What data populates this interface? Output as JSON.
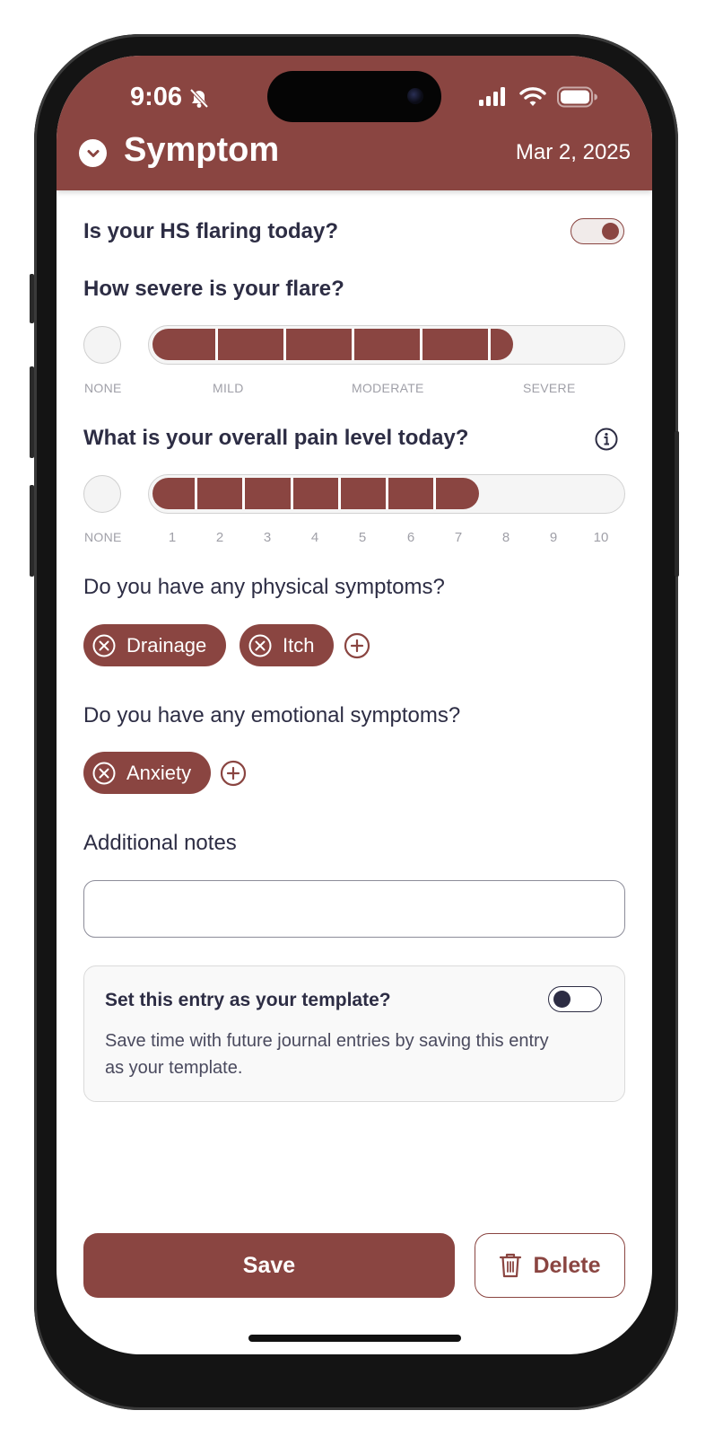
{
  "status_bar": {
    "time": "9:06",
    "icons": [
      "bell-slash-icon",
      "cellular-signal-icon",
      "wifi-icon",
      "battery-icon"
    ]
  },
  "header": {
    "title": "Symptom",
    "date": "Mar 2, 2025",
    "collapse_icon": "chevron-down-icon"
  },
  "flare": {
    "question": "Is your HS flaring today?",
    "toggle_on": true
  },
  "severity": {
    "question": "How severe is your flare?",
    "labels": [
      "NONE",
      "MILD",
      "MODERATE",
      "SEVERE"
    ],
    "filled_steps": 5.5,
    "total_steps": 7
  },
  "pain": {
    "question": "What is your overall pain level today?",
    "info_icon": "info-icon",
    "labels": [
      "NONE",
      "1",
      "2",
      "3",
      "4",
      "5",
      "6",
      "7",
      "8",
      "9",
      "10"
    ],
    "value": 7
  },
  "physical": {
    "question": "Do you have any physical symptoms?",
    "chips": [
      "Drainage",
      "Itch"
    ]
  },
  "emotional": {
    "question": "Do you have any emotional symptoms?",
    "chips": [
      "Anxiety"
    ]
  },
  "notes": {
    "label": "Additional notes",
    "value": ""
  },
  "template": {
    "title": "Set this entry as your template?",
    "description": "Save time with future journal entries by saving this entry as your template.",
    "toggle_on": false
  },
  "actions": {
    "save_label": "Save",
    "delete_label": "Delete"
  },
  "colors": {
    "brand": "#8a4541",
    "text": "#2d2d44",
    "muted": "#a0a0a8"
  }
}
